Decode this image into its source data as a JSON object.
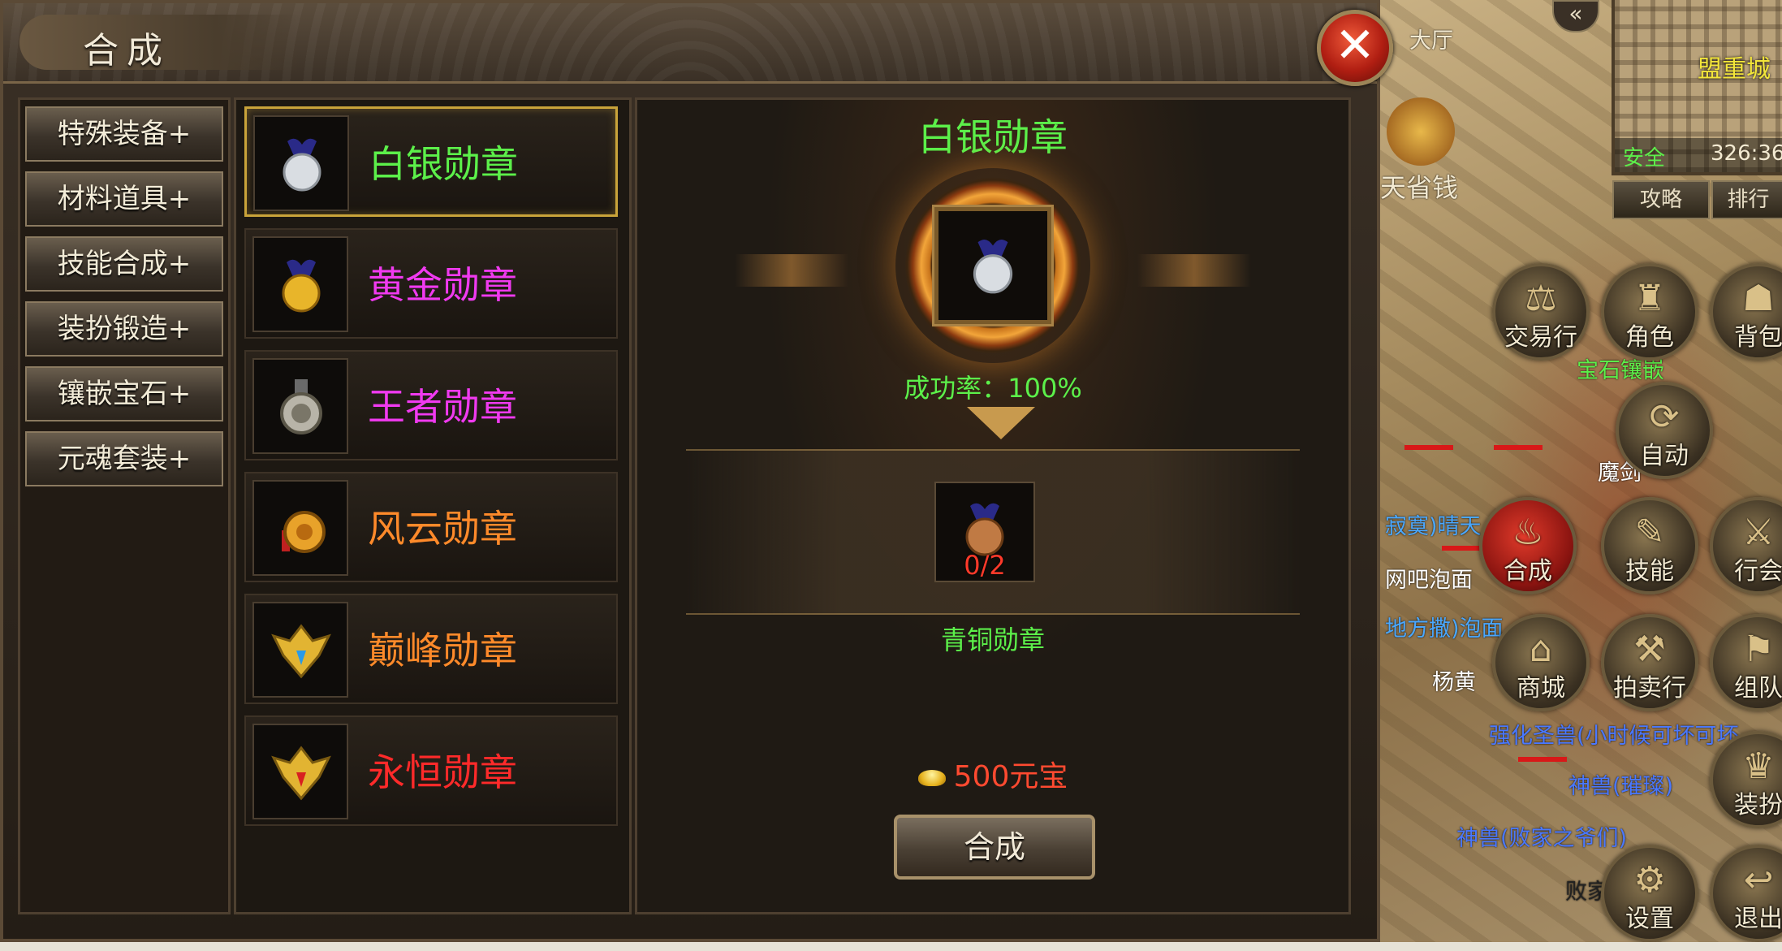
{
  "panel": {
    "title": "合成",
    "close_label": "✕",
    "categories": [
      {
        "label": "特殊装备+"
      },
      {
        "label": "材料道具+"
      },
      {
        "label": "技能合成+"
      },
      {
        "label": "装扮锻造+"
      },
      {
        "label": "镶嵌宝石+"
      },
      {
        "label": "元魂套装+"
      }
    ],
    "items": [
      {
        "name": "白银勋章",
        "color": "#5cf04a",
        "selected": true
      },
      {
        "name": "黄金勋章",
        "color": "#f03af0"
      },
      {
        "name": "王者勋章",
        "color": "#f03af0"
      },
      {
        "name": "风云勋章",
        "color": "#ff8a2a"
      },
      {
        "name": "巅峰勋章",
        "color": "#ff8a2a"
      },
      {
        "name": "永恒勋章",
        "color": "#ff2a2a"
      }
    ],
    "detail": {
      "target_name": "白银勋章",
      "success_rate": "成功率：100%",
      "material_count": "0/2",
      "material_name": "青铜勋章",
      "cost": "500元宝",
      "craft_button": "合成"
    }
  },
  "hud": {
    "minimap": {
      "city": "盟重城",
      "zone": "安全",
      "coords": "326:36"
    },
    "top_buttons": {
      "guide": "攻略",
      "rank": "排行"
    },
    "hall_label": "大厅",
    "promo_label": "天省钱",
    "round_buttons": [
      {
        "label": "交易行",
        "icon": "trade-icon"
      },
      {
        "label": "角色",
        "icon": "helmet-icon"
      },
      {
        "label": "背包",
        "icon": "bag-icon"
      },
      {
        "label": "自动",
        "icon": "auto-icon"
      },
      {
        "label": "合成",
        "icon": "craft-icon"
      },
      {
        "label": "技能",
        "icon": "skill-book-icon"
      },
      {
        "label": "行会",
        "icon": "guild-icon"
      },
      {
        "label": "商城",
        "icon": "shop-icon"
      },
      {
        "label": "拍卖行",
        "icon": "auction-icon"
      },
      {
        "label": "组队",
        "icon": "team-icon"
      },
      {
        "label": "装扮",
        "icon": "dress-icon"
      },
      {
        "label": "设置",
        "icon": "gear-icon"
      },
      {
        "label": "退出",
        "icon": "exit-icon"
      }
    ],
    "world_texts": [
      {
        "text": "宝石镶嵌",
        "color": "#5cf04a"
      },
      {
        "text": "魔剑",
        "color": "#ffffff"
      },
      {
        "text": "寂寞)晴天",
        "color": "#4aa8ff"
      },
      {
        "text": "网吧泡面",
        "color": "#ffffff"
      },
      {
        "text": "地方撒)泡面",
        "color": "#4aa8ff"
      },
      {
        "text": "杨黄",
        "color": "#ffffff"
      },
      {
        "text": "强化圣兽(小时候可坏可坏",
        "color": "#4a78ff"
      },
      {
        "text": "神兽(璀璨)",
        "color": "#4a78ff"
      },
      {
        "text": "神兽(败家之爷们)",
        "color": "#4a78ff"
      },
      {
        "text": "败家",
        "color": "#222222"
      }
    ]
  }
}
